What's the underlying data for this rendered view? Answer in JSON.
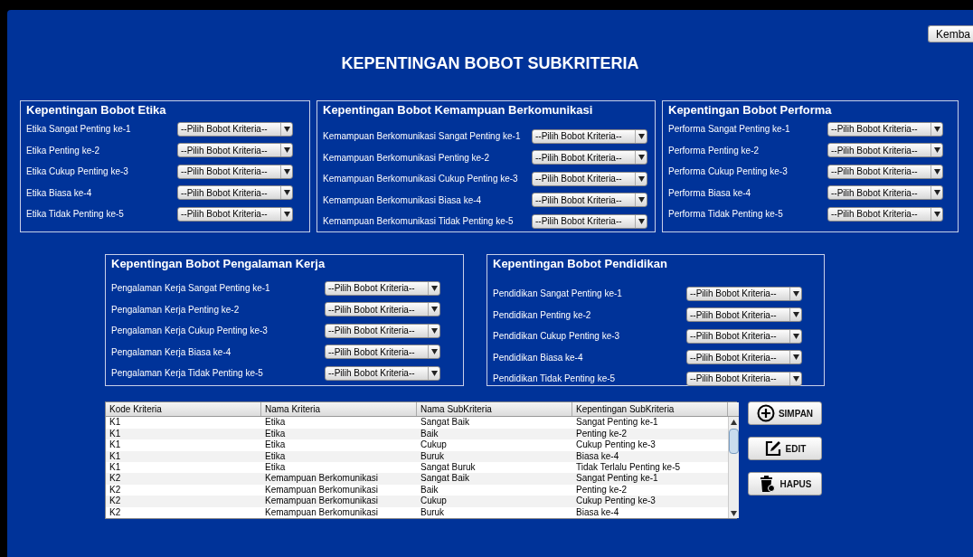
{
  "window": {
    "title": "KEPENTINGAN BOBOT SUBKRITERIA"
  },
  "back_button": {
    "label": "Kemba"
  },
  "panels": [
    {
      "title": "Kepentingan Bobot Etika",
      "rows": [
        {
          "label": "Etika Sangat Penting ke-1",
          "value": "--Pilih Bobot Kriteria--"
        },
        {
          "label": "Etika Penting ke-2",
          "value": "--Pilih Bobot Kriteria--"
        },
        {
          "label": "Etika Cukup Penting ke-3",
          "value": "--Pilih Bobot Kriteria--"
        },
        {
          "label": "Etika Biasa ke-4",
          "value": "--Pilih Bobot Kriteria--"
        },
        {
          "label": "Etika Tidak Penting ke-5",
          "value": "--Pilih Bobot Kriteria--"
        }
      ]
    },
    {
      "title": "Kepentingan Bobot Kemampuan Berkomunikasi",
      "rows": [
        {
          "label": "Kemampuan Berkomunikasi Sangat Penting ke-1",
          "value": "--Pilih Bobot Kriteria--"
        },
        {
          "label": "Kemampuan Berkomunikasi Penting ke-2",
          "value": "--Pilih Bobot Kriteria--"
        },
        {
          "label": "Kemampuan Berkomunikasi Cukup Penting ke-3",
          "value": "--Pilih Bobot Kriteria--"
        },
        {
          "label": "Kemampuan Berkomunikasi Biasa ke-4",
          "value": "--Pilih Bobot Kriteria--"
        },
        {
          "label": "Kemampuan Berkomunikasi Tidak Penting ke-5",
          "value": "--Pilih Bobot Kriteria--"
        }
      ]
    },
    {
      "title": "Kepentingan Bobot Performa",
      "rows": [
        {
          "label": "Performa Sangat Penting ke-1",
          "value": "--Pilih Bobot Kriteria--"
        },
        {
          "label": "Performa Penting ke-2",
          "value": "--Pilih Bobot Kriteria--"
        },
        {
          "label": "Performa Cukup Penting ke-3",
          "value": "--Pilih Bobot Kriteria--"
        },
        {
          "label": "Performa Biasa ke-4",
          "value": "--Pilih Bobot Kriteria--"
        },
        {
          "label": "Performa Tidak Penting ke-5",
          "value": "--Pilih Bobot Kriteria--"
        }
      ]
    },
    {
      "title": "Kepentingan Bobot Pengalaman Kerja",
      "rows": [
        {
          "label": "Pengalaman Kerja Sangat Penting ke-1",
          "value": "--Pilih Bobot Kriteria--"
        },
        {
          "label": "Pengalaman Kerja Penting ke-2",
          "value": "--Pilih Bobot Kriteria--"
        },
        {
          "label": "Pengalaman Kerja Cukup Penting ke-3",
          "value": "--Pilih Bobot Kriteria--"
        },
        {
          "label": "Pengalaman Kerja Biasa ke-4",
          "value": "--Pilih Bobot Kriteria--"
        },
        {
          "label": "Pengalaman Kerja Tidak Penting ke-5",
          "value": "--Pilih Bobot Kriteria--"
        }
      ]
    },
    {
      "title": "Kepentingan Bobot Pendidikan",
      "rows": [
        {
          "label": "Pendidikan Sangat Penting ke-1",
          "value": "--Pilih Bobot Kriteria--"
        },
        {
          "label": "Pendidikan Penting ke-2",
          "value": "--Pilih Bobot Kriteria--"
        },
        {
          "label": "Pendidikan Cukup Penting ke-3",
          "value": "--Pilih Bobot Kriteria--"
        },
        {
          "label": "Pendidikan Biasa ke-4",
          "value": "--Pilih Bobot Kriteria--"
        },
        {
          "label": "Pendidikan Tidak Penting ke-5",
          "value": "--Pilih Bobot Kriteria--"
        }
      ]
    }
  ],
  "table": {
    "columns": [
      "Kode Kriteria",
      "Nama Kriteria",
      "Nama SubKriteria",
      "Kepentingan SubKriteria"
    ],
    "rows": [
      [
        "K1",
        "Etika",
        "Sangat Baik",
        "Sangat Penting ke-1"
      ],
      [
        "K1",
        "Etika",
        "Baik",
        "Penting ke-2"
      ],
      [
        "K1",
        "Etika",
        "Cukup",
        "Cukup Penting ke-3"
      ],
      [
        "K1",
        "Etika",
        "Buruk",
        "Biasa ke-4"
      ],
      [
        "K1",
        "Etika",
        "Sangat Buruk",
        "Tidak Terlalu Penting ke-5"
      ],
      [
        "K2",
        "Kemampuan Berkomunikasi",
        "Sangat Baik",
        "Sangat Penting ke-1"
      ],
      [
        "K2",
        "Kemampuan Berkomunikasi",
        "Baik",
        "Penting ke-2"
      ],
      [
        "K2",
        "Kemampuan Berkomunikasi",
        "Cukup",
        "Cukup Penting ke-3"
      ],
      [
        "K2",
        "Kemampuan Berkomunikasi",
        "Buruk",
        "Biasa ke-4"
      ]
    ]
  },
  "actions": [
    {
      "kind": "add",
      "label": "SIMPAN"
    },
    {
      "kind": "edit",
      "label": "EDIT"
    },
    {
      "kind": "delete",
      "label": "HAPUS"
    }
  ]
}
